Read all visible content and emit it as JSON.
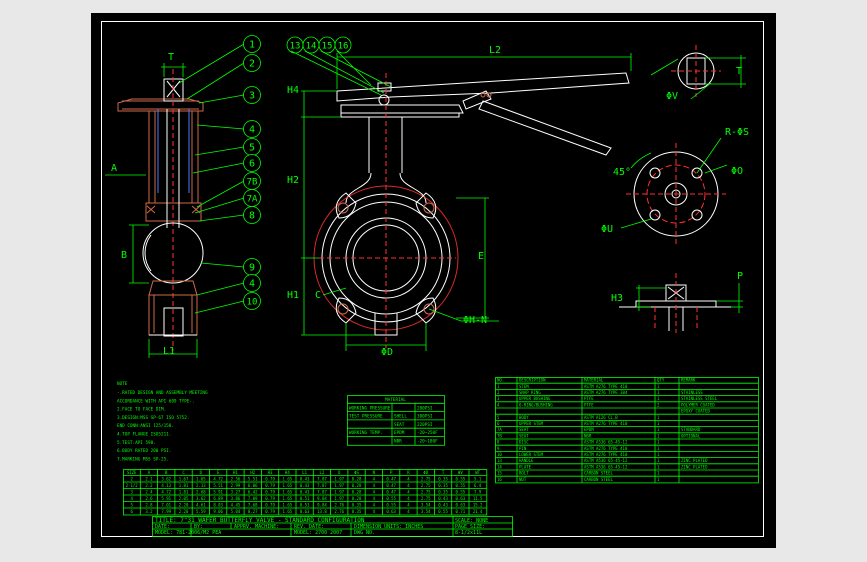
{
  "balloons": [
    "1",
    "2",
    "3",
    "4",
    "5",
    "6",
    "7B",
    "7A",
    "8",
    "9",
    "4",
    "10"
  ],
  "top_balloons": [
    "13",
    "14",
    "15",
    "16"
  ],
  "dims": {
    "T": "T",
    "A": "A",
    "B": "B",
    "L1": "L1",
    "L2": "L2",
    "H4": "H4",
    "H2": "H2",
    "H1": "H1",
    "E": "E",
    "C": "C",
    "phiD": "ΦD",
    "phiH_N": "ΦH-N",
    "T_top": "T",
    "phiV": "ΦV",
    "R_phiS": "R-ΦS",
    "angle45": "45°",
    "phiO": "ΦO",
    "phiU": "ΦU",
    "H3": "H3",
    "P": "P"
  },
  "notes_heading": "NOTE",
  "notes_lines": [
    "-.RATED DESIGN AND ASSEMBLY MEETING",
    "ACCORDANCE WITH API 609 TYPE-.",
    "2.FACE TO FACE DIM.",
    "3.DESIGN:MSS SP-67 ISO 5752.",
    "  END CONN:ANSI 125/150.",
    "4.TOP FLANGE ISO5211.",
    "5.TEST:API 598.",
    "6.BODY RATED 200 PSI.",
    "7.MARKING MSS SP-25."
  ],
  "spec_title": "MATERIAL",
  "spec_rows": [
    [
      "WORKING PRESSURE",
      "",
      "200PSI"
    ],
    [
      "TEST PRESSURE",
      "SHELL",
      "300PSI"
    ],
    [
      "",
      "SEAT",
      "220PSI"
    ],
    [
      "WORKING TEMP.",
      "EPDM",
      "-20~250F"
    ],
    [
      "",
      "NBR",
      "-20~180F"
    ]
  ],
  "dim_table_headers": [
    "SIZE",
    "A",
    "B",
    "C",
    "D",
    "E",
    "H1",
    "H2",
    "H3",
    "H4",
    "L1",
    "L2",
    "O",
    "ΦS",
    "N",
    "P",
    "R",
    "ΦU",
    "T",
    "ΦV",
    "WT"
  ],
  "dim_table_rows": [
    [
      "2",
      "2.1",
      "3.62",
      "1.67",
      "1.65",
      "4.72",
      "2.56",
      "5.51",
      "0.79",
      "1.65",
      "0.43",
      "7.87",
      "1.97",
      "0.28",
      "4",
      "0.47",
      "4",
      "2.75",
      "0.35",
      "0.55",
      "5.1"
    ],
    [
      "2-1/2",
      "2.2",
      "4.13",
      "1.81",
      "2.13",
      "5.51",
      "2.99",
      "6.06",
      "0.79",
      "1.65",
      "0.43",
      "7.87",
      "1.97",
      "0.28",
      "4",
      "0.47",
      "4",
      "2.75",
      "0.35",
      "0.55",
      "6.4"
    ],
    [
      "3",
      "2.4",
      "4.72",
      "1.81",
      "2.68",
      "5.91",
      "3.27",
      "6.42",
      "0.79",
      "1.65",
      "0.43",
      "7.87",
      "1.97",
      "0.28",
      "4",
      "0.47",
      "4",
      "2.75",
      "0.35",
      "0.55",
      "7.9"
    ],
    [
      "4",
      "2.6",
      "5.91",
      "2.05",
      "3.62",
      "6.89",
      "3.86",
      "7.09",
      "0.79",
      "1.65",
      "0.51",
      "9.84",
      "1.97",
      "0.28",
      "4",
      "0.55",
      "4",
      "2.75",
      "0.43",
      "0.63",
      "11.5"
    ],
    [
      "5",
      "2.8",
      "7.01",
      "2.20",
      "4.61",
      "8.03",
      "4.45",
      "7.68",
      "0.79",
      "1.65",
      "0.51",
      "9.84",
      "2.76",
      "0.35",
      "4",
      "0.55",
      "4",
      "3.54",
      "0.43",
      "0.63",
      "15.2"
    ],
    [
      "6",
      "3.2",
      "7.99",
      "2.20",
      "5.59",
      "9.06",
      "5.04",
      "8.27",
      "0.79",
      "1.65",
      "0.63",
      "13.8",
      "2.76",
      "0.35",
      "4",
      "0.63",
      "4",
      "3.54",
      "0.55",
      "0.71",
      "21.4"
    ]
  ],
  "parts_headers": [
    "NO.",
    "DESCRIPTION",
    "MATERIAL",
    "QTY",
    "REMARK"
  ],
  "parts_rows": [
    [
      "1",
      "STEM",
      "ASTM A276 TYPE 410",
      "1",
      ""
    ],
    [
      "2",
      "SNAP RING",
      "ASTM A276 TYPE 304",
      "1",
      "STAINLESS"
    ],
    [
      "3",
      "UPPER BUSHING",
      "PTFE",
      "1",
      "STAINLESS STEEL"
    ],
    [
      "4",
      "O-RING/BUSHING",
      "PTFE",
      "2",
      "POLYMER COATED"
    ],
    [
      "",
      "",
      "",
      "",
      "EPOXY COATED"
    ],
    [
      "5",
      "BODY",
      "ASTM A126 CL.B",
      "1",
      ""
    ],
    [
      "6",
      "UPPER STEM",
      "ASTM A276 TYPE 410",
      "1",
      ""
    ],
    [
      "7A",
      "SEAT",
      "EPDM",
      "1",
      "STANDARD"
    ],
    [
      "7B",
      "SEAT",
      "NBR",
      "1",
      "OPTIONAL"
    ],
    [
      "8",
      "DISC",
      "ASTM A536 65-45-12",
      "1",
      ""
    ],
    [
      "9",
      "PIN",
      "ASTM A276 TYPE 410",
      "1",
      ""
    ],
    [
      "10",
      "LOWER STEM",
      "ASTM A276 TYPE 410",
      "1",
      ""
    ],
    [
      "13",
      "HANDLE",
      "ASTM A536 65-45-12",
      "1",
      "ZINC PLATED"
    ],
    [
      "14",
      "PLATE",
      "ASTM A536 65-45-12",
      "1",
      "ZINC PLATED"
    ],
    [
      "15",
      "BOLT",
      "CARBON STEEL",
      "1",
      ""
    ],
    [
      "16",
      "NUT",
      "CARBON STEEL",
      "1",
      ""
    ]
  ],
  "title_block": {
    "title": "TITLE: 7\"31 WAFER BUTTERFLY VALVE - STANDARD CONFIGURATION",
    "date_label": "DATE:",
    "by_label": "BY:",
    "apprv_label": "APPRV. MACHINE:",
    "by_label2": "BY:",
    "revdate": "REV. DATE:",
    "dims_label": "DIMENSION UNITS: INCHES",
    "scale": "SCALE: NONE",
    "model": "MODEL: 781-2006/M2 PEA",
    "model2": "MODEL: 2700 2007",
    "dwg": "DWG NO.",
    "page": "PAGE SIZE:",
    "page_size": "8-1/2x11L"
  }
}
